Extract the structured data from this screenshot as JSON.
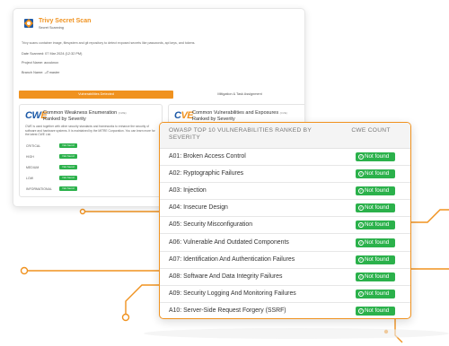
{
  "colors": {
    "accent": "#f0921f",
    "success": "#2bb14b",
    "cwe_blue": "#1d5aa8"
  },
  "report": {
    "title": "Trivy Secret Scan",
    "subtitle": "Secret Scanning",
    "description": "Trivy scans container image, filesystem and git repository to detect exposed secrets like passwords, api keys, and tokens.",
    "date_scanned": "Date Scanned: 07 Mar 2024 (12:32 PM)",
    "project_name": "Project Name: accuknox",
    "branch_name": "Branch Name: ⎇ master",
    "tabs": [
      "Vulnerabilities Detected",
      "Mitigation & Task Assignment"
    ],
    "cwe": {
      "logo": "CWE",
      "title": "Common Weakness Enumeration",
      "abbr": "(CWE)",
      "subtitle": "Ranked by Severity",
      "description": "CWE is used together with other security standards and frameworks to enhance the security of software and hardware systems. It is maintained by the MITRE Corporation. You can learn more for the latest CWE List.",
      "severities": [
        "CRITICAL",
        "HIGH",
        "MEDIUM",
        "LOW",
        "INFORMATIONAL"
      ],
      "status": "Not found"
    },
    "cve": {
      "logo": "CVE",
      "title": "Common Vulnerabilities and Exposures",
      "abbr": "(CVE)",
      "subtitle": "Ranked by Severity",
      "description": "CVE serves as a way to track and catalog security vulnerabilities and exposures. It is a list of publicly disclosed cybersecurity vulnerabilities, maintained by the MITRE Corporation.",
      "severities": [
        "CRITICAL",
        "HIGH",
        "MEDIUM",
        "LOW",
        "INFORMATIONAL"
      ]
    }
  },
  "owasp": {
    "header_left": "OWASP TOP 10 VULNERABILITIES RANKED BY SEVERITY",
    "header_right": "CWE COUNT",
    "status": "Not found",
    "rows": [
      "A01: Broken Access Control",
      "A02: Ryptographic Failures",
      "A03: Injection",
      "A04: Insecure Design",
      "A05: Security Misconfiguration",
      "A06: Vulnerable And Outdated Components",
      "A07: Identification And Authentication Failures",
      "A08: Software And Data Integrity Failures",
      "A09: Security Logging And Monitoring Failures",
      "A10: Server-Side Request Forgery (SSRF)"
    ]
  }
}
